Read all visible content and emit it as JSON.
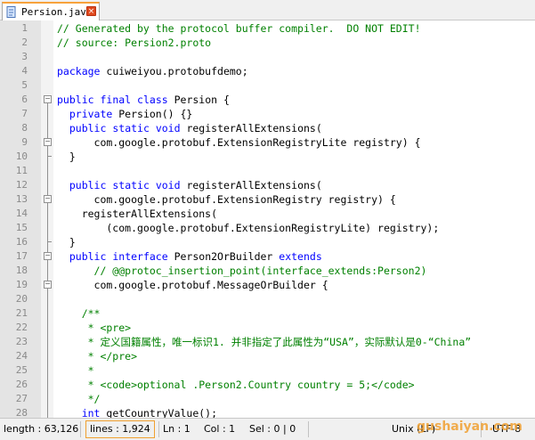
{
  "tab": {
    "title": "Persion.java",
    "close_glyph": "×",
    "icon": "file-icon"
  },
  "editor": {
    "lines": [
      {
        "n": "1",
        "text": "// Generated by the protocol buffer compiler.  DO NOT EDIT!",
        "cls": "cm",
        "fold": ""
      },
      {
        "n": "2",
        "text": "// source: Persion2.proto",
        "cls": "cm",
        "fold": ""
      },
      {
        "n": "3",
        "text": "",
        "cls": "",
        "fold": ""
      },
      {
        "n": "4",
        "text": "package cuiweiyou.protobufdemo;",
        "cls": "",
        "fold": ""
      },
      {
        "n": "5",
        "text": "",
        "cls": "",
        "fold": ""
      },
      {
        "n": "6",
        "text": "public final class Persion {",
        "cls": "",
        "fold": "open"
      },
      {
        "n": "7",
        "text": "  private Persion() {}",
        "cls": "",
        "fold": "line"
      },
      {
        "n": "8",
        "text": "  public static void registerAllExtensions(",
        "cls": "",
        "fold": "line"
      },
      {
        "n": "9",
        "text": "      com.google.protobuf.ExtensionRegistryLite registry) {",
        "cls": "",
        "fold": "open"
      },
      {
        "n": "10",
        "text": "  }",
        "cls": "",
        "fold": "end"
      },
      {
        "n": "11",
        "text": "",
        "cls": "",
        "fold": "line"
      },
      {
        "n": "12",
        "text": "  public static void registerAllExtensions(",
        "cls": "",
        "fold": "line"
      },
      {
        "n": "13",
        "text": "      com.google.protobuf.ExtensionRegistry registry) {",
        "cls": "",
        "fold": "open"
      },
      {
        "n": "14",
        "text": "    registerAllExtensions(",
        "cls": "",
        "fold": "line"
      },
      {
        "n": "15",
        "text": "        (com.google.protobuf.ExtensionRegistryLite) registry);",
        "cls": "",
        "fold": "line"
      },
      {
        "n": "16",
        "text": "  }",
        "cls": "",
        "fold": "end"
      },
      {
        "n": "17",
        "text": "  public interface Person2OrBuilder extends",
        "cls": "",
        "fold": "open"
      },
      {
        "n": "18",
        "text": "      // @@protoc_insertion_point(interface_extends:Person2)",
        "cls": "cm",
        "fold": "line"
      },
      {
        "n": "19",
        "text": "      com.google.protobuf.MessageOrBuilder {",
        "cls": "",
        "fold": "open"
      },
      {
        "n": "20",
        "text": "",
        "cls": "",
        "fold": "line"
      },
      {
        "n": "21",
        "text": "    /**",
        "cls": "cm",
        "fold": "line"
      },
      {
        "n": "22",
        "text": "     * <pre>",
        "cls": "cm",
        "fold": "line"
      },
      {
        "n": "23",
        "text": "     * 定义国籍属性，唯一标识1. 并非指定了此属性为“USA”，实际默认是0-“China”",
        "cls": "cm",
        "fold": "line"
      },
      {
        "n": "24",
        "text": "     * </pre>",
        "cls": "cm",
        "fold": "line"
      },
      {
        "n": "25",
        "text": "     *",
        "cls": "cm",
        "fold": "line"
      },
      {
        "n": "26",
        "text": "     * <code>optional .Person2.Country country = 5;</code>",
        "cls": "cm",
        "fold": "line"
      },
      {
        "n": "27",
        "text": "     */",
        "cls": "cm",
        "fold": "line"
      },
      {
        "n": "28",
        "text": "    int getCountryValue();",
        "cls": "",
        "fold": "line"
      }
    ]
  },
  "status": {
    "length": "length : 63,126",
    "lines": "lines : 1,924",
    "ln": "Ln : 1",
    "col": "Col : 1",
    "sel": "Sel : 0 | 0",
    "eol": "Unix (LF)",
    "encoding": "UTF-8"
  },
  "watermark": "gushaiyan.com",
  "colors": {
    "comment": "#008000",
    "keyword": "#0000ff",
    "accent_tab": "#f7a23c",
    "close_button": "#e04a1f"
  }
}
